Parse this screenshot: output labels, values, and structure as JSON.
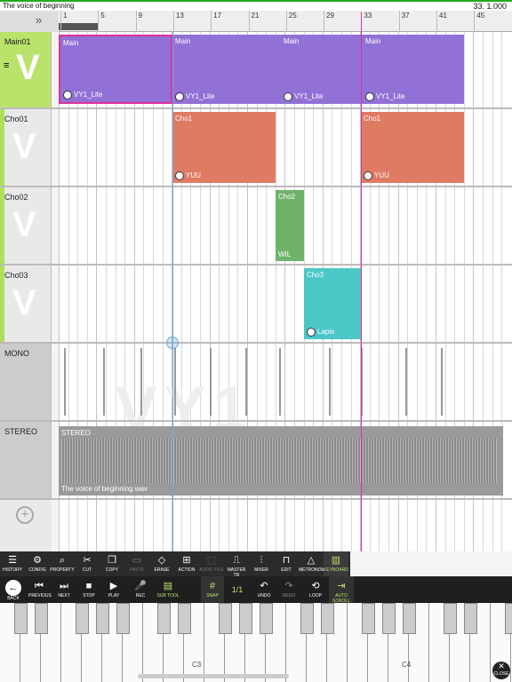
{
  "top": {
    "title": "The voice of beginning",
    "position": "33. 1.000"
  },
  "ruler": {
    "collapse_icon": "double-chevron-right-icon",
    "marks": [
      "1",
      "5",
      "9",
      "13",
      "17",
      "21",
      "25",
      "29",
      "33",
      "37",
      "41",
      "45"
    ]
  },
  "tracks": [
    {
      "name": "Main01",
      "clips": [
        {
          "label": "Main",
          "singer": "VY1_Lite"
        },
        {
          "label": "Main",
          "singer": "VY1_Lite"
        },
        {
          "label": "Main",
          "singer": "VY1_Lite"
        },
        {
          "label": "Main",
          "singer": "VY1_Lite"
        }
      ]
    },
    {
      "name": "Cho01",
      "clips": [
        {
          "label": "Cho1",
          "singer": "YUU"
        },
        {
          "label": "Cho1",
          "singer": "YUU"
        }
      ]
    },
    {
      "name": "Cho02",
      "clips": [
        {
          "label": "Cho2",
          "singer": "WIL"
        }
      ]
    },
    {
      "name": "Cho03",
      "clips": [
        {
          "label": "Cho3",
          "singer": "Lapis"
        }
      ]
    },
    {
      "name": "MONO"
    },
    {
      "name": "STEREO",
      "clip": {
        "label": "STEREO",
        "file": "The voice of beginning.wav"
      }
    }
  ],
  "add_track_icon": "plus-circle-icon",
  "toolbar1": [
    {
      "label": "HISTORY",
      "icon": "history-icon"
    },
    {
      "label": "CONFIG",
      "icon": "gear-icon"
    },
    {
      "label": "PROPERTY",
      "icon": "property-icon"
    },
    {
      "label": "CUT",
      "icon": "scissors-icon"
    },
    {
      "label": "COPY",
      "icon": "copy-icon"
    },
    {
      "label": "PASTE",
      "icon": "paste-icon"
    },
    {
      "label": "ERASE",
      "icon": "eraser-icon"
    },
    {
      "label": "ACTION",
      "icon": "action-icon"
    },
    {
      "label": "AUDIO FILE",
      "icon": "audio-file-icon"
    },
    {
      "label": "MASTER TR",
      "icon": "master-track-icon"
    },
    {
      "label": "MIXER",
      "icon": "mixer-icon"
    },
    {
      "label": "EDIT",
      "icon": "edit-icon"
    },
    {
      "label": "METRONOME",
      "icon": "metronome-icon"
    },
    {
      "label": "KEYBOARD",
      "icon": "keyboard-icon"
    }
  ],
  "toolbar2": {
    "back": "BACK",
    "previous": "PREVIOUS",
    "next": "NEXT",
    "stop": "STOP",
    "play": "PLAY",
    "rec": "REC",
    "subtool": "SUB TOOL",
    "snap": "SNAP",
    "division": "1/1",
    "undo": "UNDO",
    "redo": "REDO",
    "loop": "LOOP",
    "autoscroll": "AUTO SCROLL"
  },
  "keyboard": {
    "c3": "C3",
    "c4": "C4",
    "close": "CLOSE"
  },
  "colors": {
    "main": "#9271d6",
    "cho1": "#e07b63",
    "cho2": "#6fb36a",
    "cho3": "#4cc7c7",
    "audio": "#9a9a9a",
    "playhead": "#e0309a",
    "cursor": "#6fa8dc",
    "trackgreen": "#b9e36b"
  }
}
